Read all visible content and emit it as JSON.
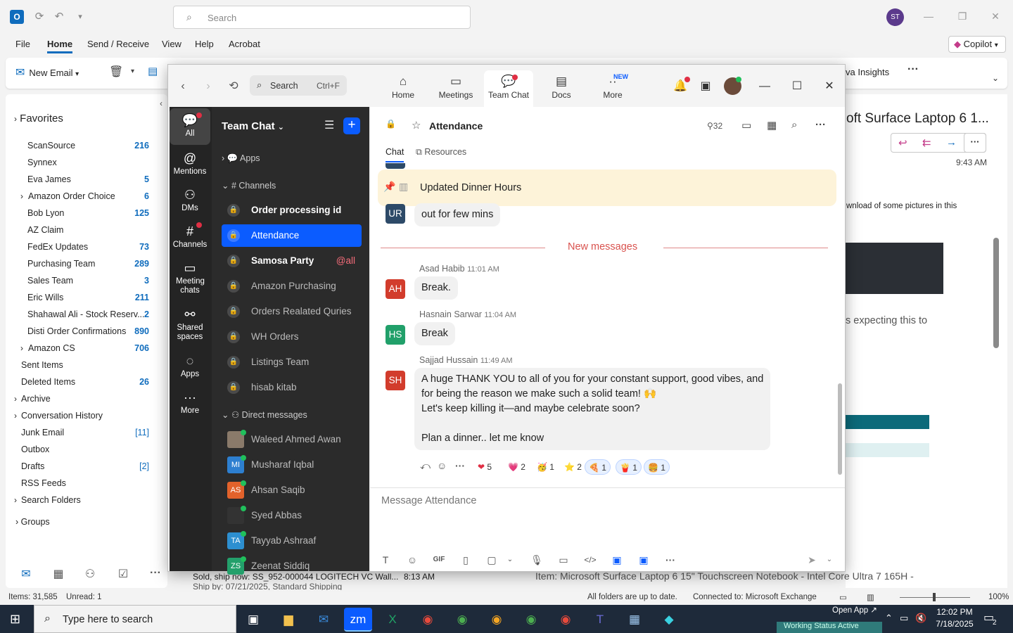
{
  "outlook": {
    "search_placeholder": "Search",
    "user_initials": "ST",
    "menu": [
      "File",
      "Home",
      "Send / Receive",
      "View",
      "Help",
      "Acrobat"
    ],
    "copilot_label": "Copilot",
    "new_email_label": "New Email",
    "viva_insights": "va Insights",
    "favorites_label": "Favorites",
    "folders": [
      {
        "name": "ScanSource",
        "count": "216",
        "indent": 2
      },
      {
        "name": "Synnex",
        "count": "",
        "indent": 2
      },
      {
        "name": "Eva James",
        "count": "5",
        "indent": 2
      },
      {
        "name": "Amazon Order Choice",
        "count": "6",
        "indent": 1,
        "expand": true
      },
      {
        "name": "Bob Lyon",
        "count": "125",
        "indent": 2
      },
      {
        "name": "AZ Claim",
        "count": "",
        "indent": 2
      },
      {
        "name": "FedEx Updates",
        "count": "73",
        "indent": 2
      },
      {
        "name": "Purchasing Team",
        "count": "289",
        "indent": 2
      },
      {
        "name": "Sales Team",
        "count": "3",
        "indent": 2
      },
      {
        "name": "Eric Wills",
        "count": "211",
        "indent": 2
      },
      {
        "name": "Shahawal Ali - Stock Reserv...",
        "count": "2",
        "indent": 2
      },
      {
        "name": "Disti Order Confirmations",
        "count": "890",
        "indent": 2
      },
      {
        "name": "Amazon CS",
        "count": "706",
        "indent": 1,
        "expand": true
      },
      {
        "name": "Sent Items",
        "count": "",
        "indent": 0
      },
      {
        "name": "Deleted Items",
        "count": "26",
        "indent": 0
      },
      {
        "name": "Archive",
        "count": "",
        "indent": 0,
        "expand": true
      },
      {
        "name": "Conversation History",
        "count": "",
        "indent": 0,
        "expand": true
      },
      {
        "name": "Junk Email",
        "count": "[11]",
        "indent": 0,
        "bracket": true
      },
      {
        "name": "Outbox",
        "count": "",
        "indent": 0
      },
      {
        "name": "Drafts",
        "count": "[2]",
        "indent": 0,
        "bracket": true
      },
      {
        "name": "RSS Feeds",
        "count": "",
        "indent": 0
      },
      {
        "name": "Search Folders",
        "count": "",
        "indent": 0,
        "expand": true
      }
    ],
    "groups_label": "Groups",
    "reading": {
      "subject": "oft Surface Laptop 6 1...",
      "time": "9:43 AM",
      "snippet1": "wnload of some pictures in this",
      "snippet2": "s expecting this to"
    },
    "list_preview": {
      "line1": "Sold, ship now: SS_952-000044 LOGITECH VC Wall...",
      "line2": "Ship by: 07/21/2025, Standard Shipping",
      "time": "8:13 AM",
      "item": "Item: Microsoft Surface Laptop 6 15\" Touchscreen Notebook - Intel Core Ultra 7 165H -"
    },
    "status": {
      "items": "Items: 31,585",
      "unread": "Unread: 1",
      "sync": "All folders are up to date.",
      "connected": "Connected to: Microsoft Exchange",
      "zoom": "100%"
    }
  },
  "taskbar": {
    "search_placeholder": "Type here to search",
    "time": "12:02 PM",
    "date": "7/18/2025",
    "notifications": "2",
    "open_app": "Open App",
    "working_status": "Working Status Active"
  },
  "zoom": {
    "search_placeholder": "Search",
    "search_shortcut": "Ctrl+F",
    "tabs": [
      {
        "label": "Home",
        "icon": "home-icon"
      },
      {
        "label": "Meetings",
        "icon": "video-icon"
      },
      {
        "label": "Team Chat",
        "icon": "chat-icon"
      },
      {
        "label": "Docs",
        "icon": "docs-icon"
      },
      {
        "label": "More",
        "icon": "more-icon"
      }
    ],
    "new_badge": "NEW",
    "rail": [
      "All",
      "Mentions",
      "DMs",
      "Channels",
      "Meeting chats",
      "Shared spaces",
      "Apps",
      "More"
    ],
    "sidebar": {
      "title": "Team Chat",
      "apps_label": "Apps",
      "channels_label": "Channels",
      "channels": [
        {
          "name": "Order processing id",
          "bold": true
        },
        {
          "name": "Attendance",
          "active": true
        },
        {
          "name": "Samosa Party",
          "bold": true,
          "mention": "@all"
        },
        {
          "name": "Amazon Purchasing"
        },
        {
          "name": "Orders Realated Quries"
        },
        {
          "name": "WH Orders"
        },
        {
          "name": "Listings Team"
        },
        {
          "name": "hisab kitab"
        }
      ],
      "dm_label": "Direct messages",
      "dms": [
        {
          "name": "Waleed Ahmed Awan",
          "initials": "",
          "color": "#8a7a6a"
        },
        {
          "name": "Musharaf Iqbal",
          "initials": "MI",
          "color": "#2d7fd0"
        },
        {
          "name": "Ahsan Saqib",
          "initials": "AS",
          "color": "#e2622b"
        },
        {
          "name": "Syed Abbas",
          "initials": "",
          "color": "#333333"
        },
        {
          "name": "Tayyab Ashraaf",
          "initials": "TA",
          "color": "#2d8fd0"
        },
        {
          "name": "Zeenat Siddiq",
          "initials": "ZS",
          "color": "#23a06b"
        }
      ]
    },
    "channel": {
      "title": "Attendance",
      "members": "32",
      "tab_chat": "Chat",
      "tab_resources": "Resources",
      "pinned": "Updated Dinner Hours",
      "prev_message": {
        "initials": "UR",
        "text": "out for few mins"
      },
      "new_messages_label": "New messages",
      "messages": [
        {
          "sender": "Asad Habib",
          "time": "11:01 AM",
          "initials": "AH",
          "color": "#d23c2c",
          "lines": [
            "Break."
          ]
        },
        {
          "sender": "Hasnain Sarwar",
          "time": "11:04 AM",
          "initials": "HS",
          "color": "#21a06a",
          "lines": [
            "Break"
          ]
        },
        {
          "sender": "Sajjad Hussain",
          "time": "11:49 AM",
          "initials": "SH",
          "color": "#d23c2c",
          "lines": [
            "A huge THANK YOU to all of you for your constant support, good vibes, and",
            "for being the reason we make such a solid team! 🙌",
            "Let's keep killing it—and maybe celebrate soon?",
            "",
            "Plan a dinner.. let me know"
          ]
        }
      ],
      "reactions": [
        {
          "emoji": "❤",
          "count": "5"
        },
        {
          "emoji": "💗",
          "count": "2"
        },
        {
          "emoji": "🥳",
          "count": "1"
        },
        {
          "emoji": "⭐",
          "count": "2"
        },
        {
          "emoji": "🍕",
          "count": "1"
        },
        {
          "emoji": "🍟",
          "count": "1"
        },
        {
          "emoji": "🍔",
          "count": "1"
        }
      ],
      "compose_placeholder": "Message Attendance",
      "gif_label": "GIF"
    }
  }
}
